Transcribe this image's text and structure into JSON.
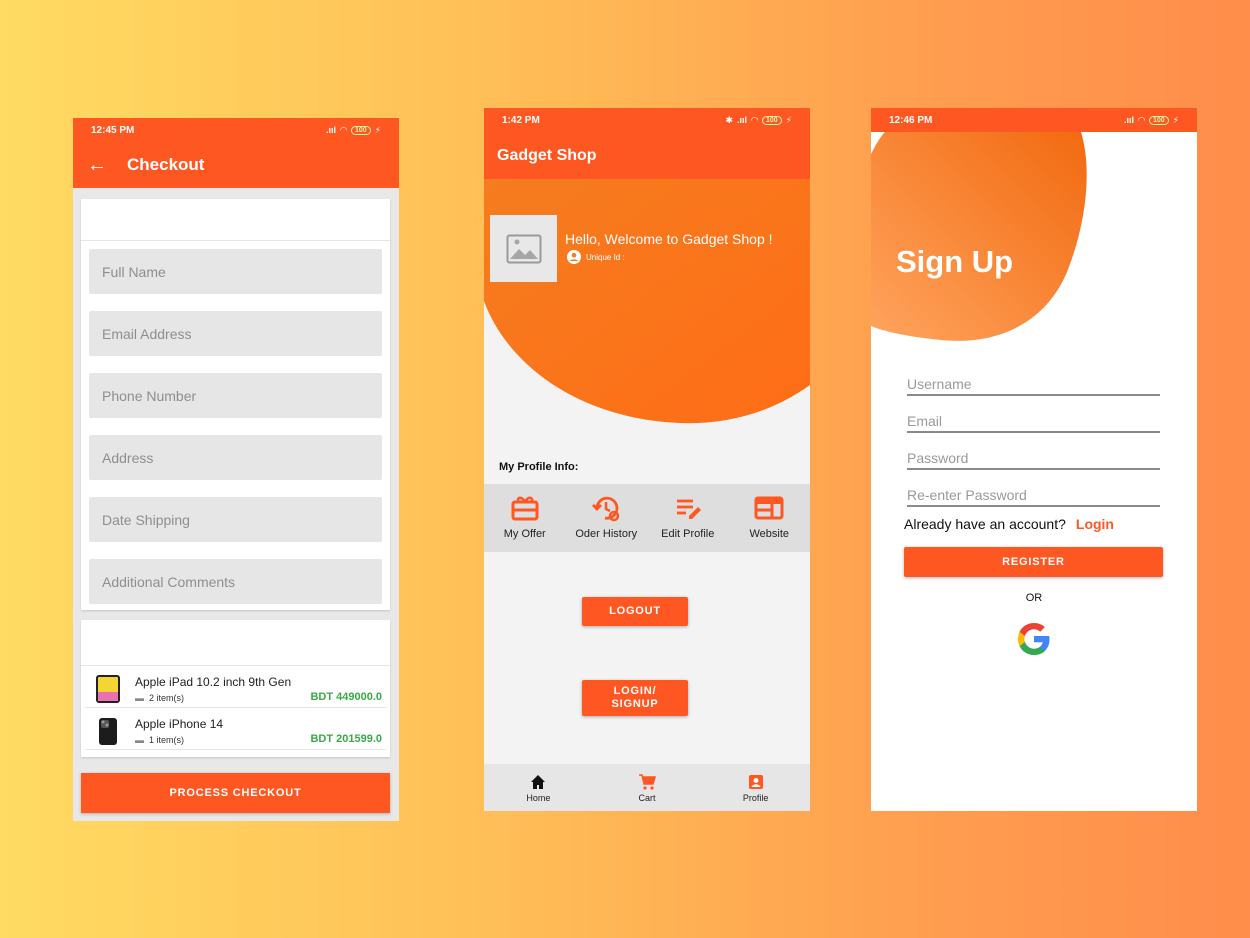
{
  "colors": {
    "accent": "#ff5722",
    "price": "#3aa845"
  },
  "checkout": {
    "status": {
      "time": "12:45 PM",
      "battery": "100"
    },
    "title": "Checkout",
    "fields": [
      "Full Name",
      "Email Address",
      "Phone Number",
      "Address",
      "Date Shipping",
      "Additional Comments"
    ],
    "items": [
      {
        "name": "Apple iPad 10.2 inch 9th Gen",
        "qty": "2 item(s)",
        "price": "BDT 449000.0"
      },
      {
        "name": "Apple iPhone 14",
        "qty": "1 item(s)",
        "price": "BDT 201599.0"
      }
    ],
    "button": "PROCESS CHECKOUT"
  },
  "profile": {
    "status": {
      "time": "1:42 PM",
      "battery": "100"
    },
    "title": "Gadget Shop",
    "hello": "Hello, Welcome to Gadget Shop !",
    "unique_id": "Unique Id :",
    "section_title": "My Profile Info:",
    "menu": [
      {
        "label": "My Offer",
        "icon": "gift-icon"
      },
      {
        "label": "Oder History",
        "icon": "history-icon"
      },
      {
        "label": "Edit Profile",
        "icon": "edit-icon"
      },
      {
        "label": "Website",
        "icon": "web-icon"
      }
    ],
    "logout": "LOGOUT",
    "login_line1": "LOGIN/",
    "login_line2": "SIGNUP",
    "nav": [
      {
        "label": "Home",
        "icon": "home-icon"
      },
      {
        "label": "Cart",
        "icon": "cart-icon"
      },
      {
        "label": "Profile",
        "icon": "profile-icon"
      }
    ]
  },
  "signup": {
    "status": {
      "time": "12:46 PM",
      "battery": "100"
    },
    "title": "Sign Up",
    "fields": [
      "Username",
      "Email",
      "Password",
      "Re-enter Password"
    ],
    "have_account": "Already have an account?",
    "login_link": "Login",
    "register": "REGISTER",
    "or": "OR"
  }
}
